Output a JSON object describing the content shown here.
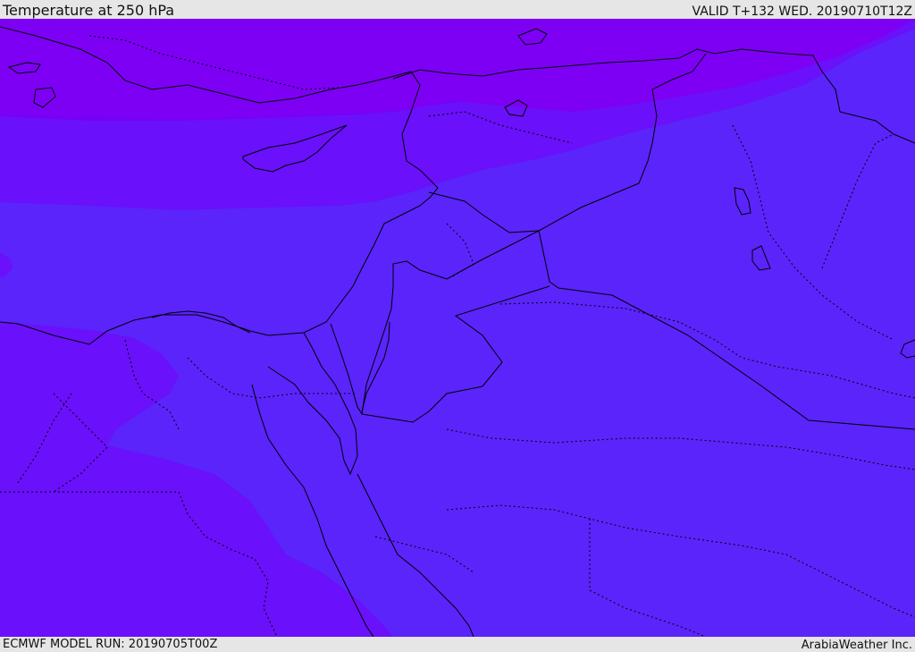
{
  "header": {
    "title": "Temperature at 250 hPa",
    "valid_time": "VALID T+132 WED. 20190710T12Z"
  },
  "footer": {
    "model_run": "ECMWF MODEL RUN: 20190705T00Z",
    "credit": "ArabiaWeather Inc."
  },
  "map": {
    "colors": {
      "coldest_band": "#7700f6",
      "cold_band": "#6a10fa",
      "cool_band": "#5a24fb",
      "warm_band": "#5c28f9",
      "coastline": "#000000",
      "border": "#000000"
    }
  }
}
